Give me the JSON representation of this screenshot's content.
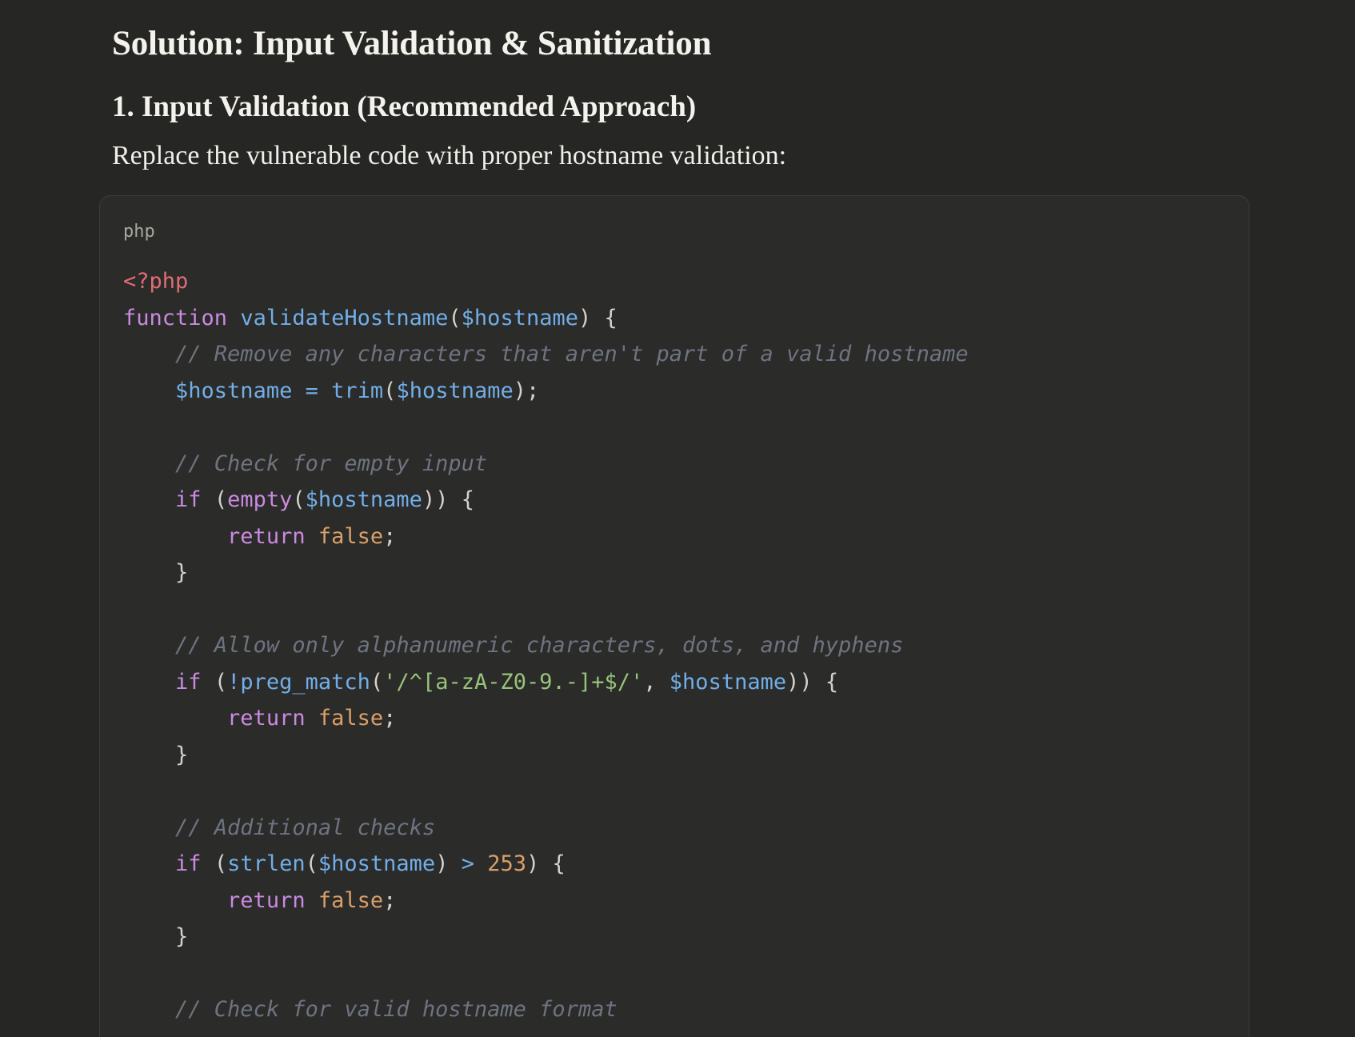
{
  "document": {
    "title": "Solution: Input Validation & Sanitization",
    "section_heading": "1. Input Validation (Recommended Approach)",
    "intro": "Replace the vulnerable code with proper hostname validation:"
  },
  "code_block": {
    "language": "php",
    "tokens": {
      "php_open": "<?php",
      "kw_function": "function",
      "fn_validate": "validateHostname",
      "var_hostname": "$hostname",
      "cm_remove": "// Remove any characters that aren't part of a valid hostname",
      "fn_trim": "trim",
      "cm_empty": "// Check for empty input",
      "kw_if": "if",
      "fn_empty": "empty",
      "kw_return": "return",
      "lit_false": "false",
      "cm_allow": "// Allow only alphanumeric characters, dots, and hyphens",
      "op_not": "!",
      "fn_preg": "preg_match",
      "str_regex": "'/^[a-zA-Z0-9.-]+$/'",
      "cm_additional": "// Additional checks",
      "fn_strlen": "strlen",
      "op_gt": ">",
      "num_253": "253",
      "cm_format": "// Check for valid hostname format"
    }
  },
  "colors": {
    "background": "#262624",
    "code_background": "#2b2b29",
    "keyword": "#c98ae0",
    "function": "#72aee8",
    "comment": "#6e7380",
    "string": "#98c379",
    "number": "#d9a06a",
    "php_tag": "#e06c75"
  }
}
